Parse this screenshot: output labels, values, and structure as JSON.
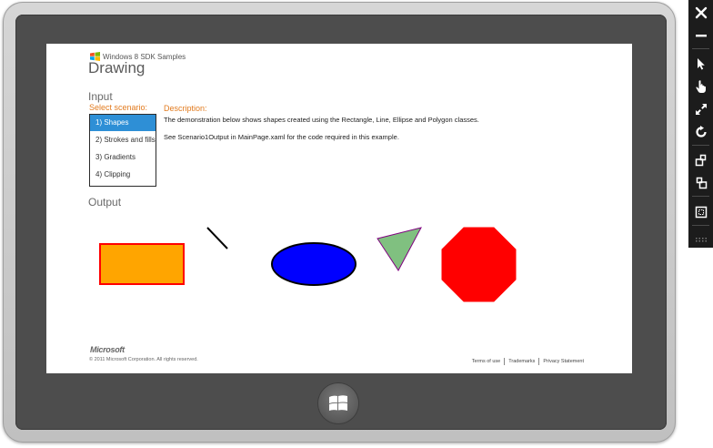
{
  "app": {
    "sdk_header": "Windows 8 SDK Samples",
    "title": "Drawing"
  },
  "input": {
    "heading": "Input",
    "select_label": "Select scenario:",
    "scenarios": [
      "1) Shapes",
      "2) Strokes and fills",
      "3) Gradients",
      "4) Clipping"
    ],
    "selected_index": 0
  },
  "description": {
    "heading": "Description:",
    "line1": "The demonstration below shows shapes created using the Rectangle, Line, Ellipse and Polygon classes.",
    "line2": "See Scenario1Output in MainPage.xaml for the code required in this example."
  },
  "output": {
    "heading": "Output",
    "shapes": [
      {
        "kind": "rectangle",
        "fill": "#FFA500",
        "stroke": "#FF0000"
      },
      {
        "kind": "line",
        "stroke": "#000000"
      },
      {
        "kind": "ellipse",
        "fill": "#0000FF",
        "stroke": "#000000"
      },
      {
        "kind": "polygon",
        "name": "triangle",
        "fill": "#80C080",
        "stroke": "#800080"
      },
      {
        "kind": "polygon",
        "name": "octagon",
        "fill": "#FF0000",
        "stroke": "#FF0000"
      }
    ]
  },
  "footer": {
    "brand": "Microsoft",
    "copyright": "© 2011 Microsoft Corporation. All rights reserved.",
    "links": [
      "Terms of use",
      "Trademarks",
      "Privacy Statement"
    ]
  },
  "toolbar": {
    "icons": [
      "close-icon",
      "minimize-icon",
      "mouse-mode-icon",
      "touch-mode-icon",
      "pinch-zoom-icon",
      "rotate-icon",
      "rotate-clockwise-icon",
      "rotate-counterclockwise-icon",
      "resolution-icon",
      "more-icon"
    ]
  },
  "colors": {
    "accent_blue": "#2E8FD6",
    "label_orange": "#E27B1F",
    "bezel": "#4D4D4D"
  }
}
